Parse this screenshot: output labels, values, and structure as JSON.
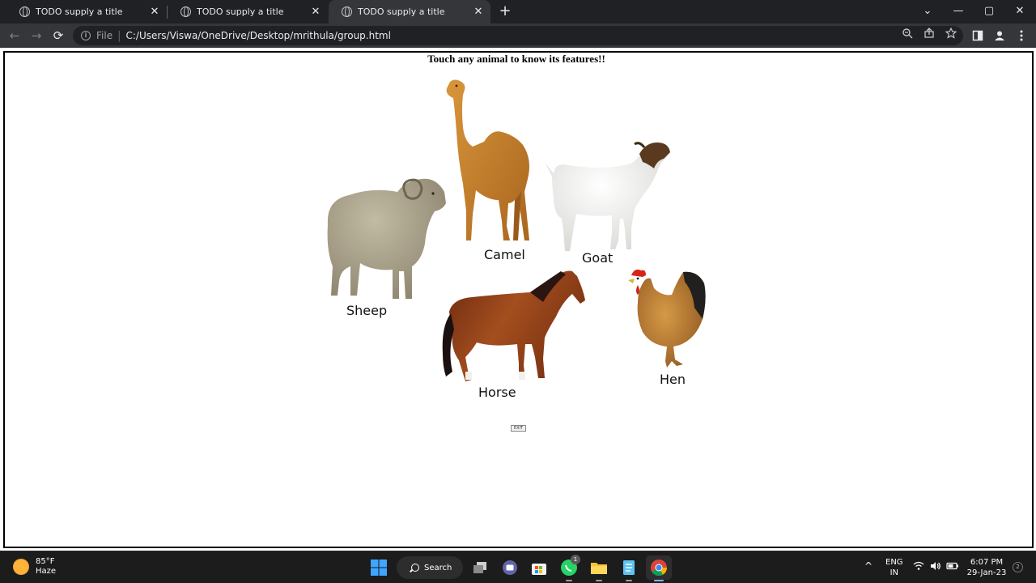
{
  "browser": {
    "tabs": [
      {
        "title": "TODO supply a title",
        "close": "✕"
      },
      {
        "title": "TODO supply a title",
        "close": "✕"
      },
      {
        "title": "TODO supply a title",
        "close": "✕"
      }
    ],
    "new_tab": "+",
    "window_controls": {
      "tab_search": "⌄",
      "minimize": "—",
      "maximize": "▢",
      "close": "✕"
    },
    "nav": {
      "back": "←",
      "forward": "→",
      "reload": "⟳"
    },
    "address": {
      "scheme": "File",
      "separator": "|",
      "url": "C:/Users/Viswa/OneDrive/Desktop/mrithula/group.html"
    },
    "icons": [
      "zoom-icon",
      "share-icon",
      "star-icon",
      "side-panel-icon",
      "profile-icon",
      "menu-icon"
    ]
  },
  "page": {
    "heading": "Touch any animal to know its features!!",
    "animals": [
      {
        "key": "camel",
        "label": "Camel",
        "color": "#c8832e"
      },
      {
        "key": "goat",
        "label": "Goat",
        "color": "#ececea"
      },
      {
        "key": "sheep",
        "label": "Sheep",
        "color": "#a8a08a"
      },
      {
        "key": "horse",
        "label": "Horse",
        "color": "#8b3f1a"
      },
      {
        "key": "hen",
        "label": "Hen",
        "color": "#b8742c"
      }
    ],
    "exit_label": "EXIT"
  },
  "taskbar": {
    "weather": {
      "temp": "85°F",
      "condition": "Haze"
    },
    "search_label": "Search",
    "whatsapp_badge": "1",
    "tray": {
      "language": "ENG",
      "region": "IN",
      "time": "6:07 PM",
      "date": "29-Jan-23",
      "notifications": "2",
      "chevron": "^"
    }
  }
}
